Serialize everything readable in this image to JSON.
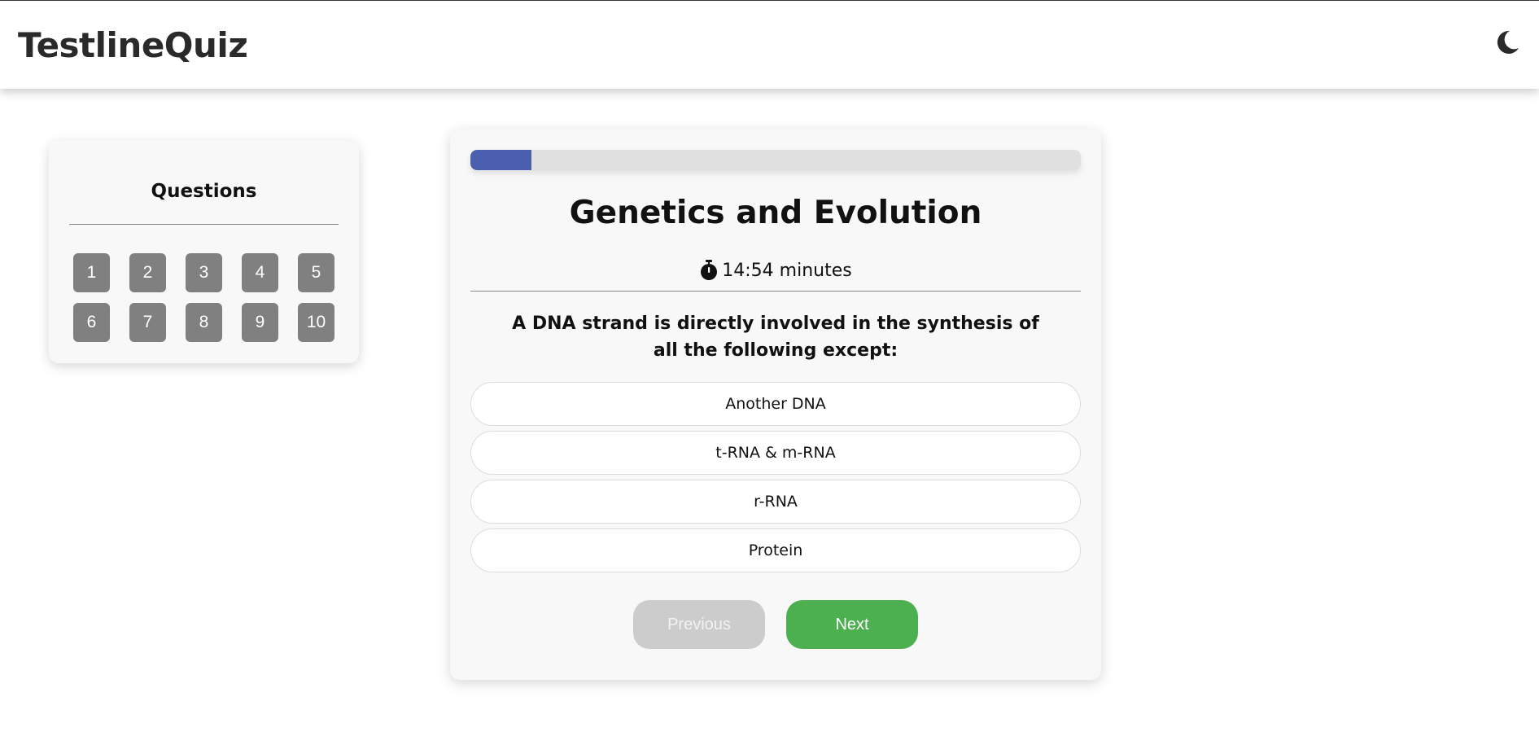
{
  "header": {
    "brand": "TestlineQuiz",
    "theme_toggle_icon": "moon-icon"
  },
  "sidebar": {
    "title": "Questions",
    "question_numbers": [
      "1",
      "2",
      "3",
      "4",
      "5",
      "6",
      "7",
      "8",
      "9",
      "10"
    ]
  },
  "quiz": {
    "progress": 0.1,
    "title": "Genetics and Evolution",
    "timer_icon": "stopwatch-icon",
    "timer_text": "14:54 minutes",
    "question": "A DNA strand is directly involved in the synthesis of all the following except:",
    "options": [
      "Another DNA",
      "t-RNA & m-RNA",
      "r-RNA",
      "Protein"
    ],
    "previous_label": "Previous",
    "next_label": "Next"
  },
  "colors": {
    "progress_fill": "#4a5fae",
    "next_button": "#4caf50",
    "previous_button_disabled": "#cccccc",
    "question_button": "#808080"
  }
}
